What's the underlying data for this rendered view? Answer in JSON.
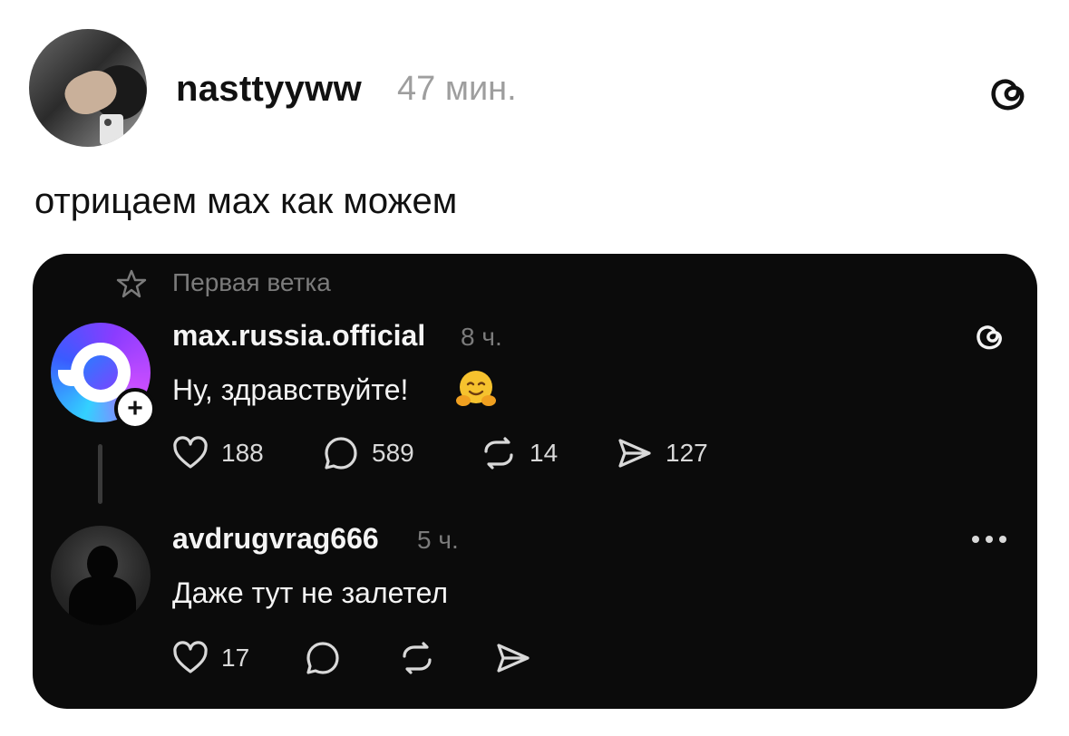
{
  "post": {
    "username": "nasttyyww",
    "time": "47 мин.",
    "text": "отрицаем мах как можем"
  },
  "embed": {
    "thread_label": "Первая ветка",
    "reply1": {
      "username": "max.russia.official",
      "time": "8 ч.",
      "text": "Ну, здравствуйте!",
      "emoji": "hugging-face",
      "follow_symbol": "+",
      "likes": "188",
      "comments": "589",
      "reposts": "14",
      "shares": "127"
    },
    "reply2": {
      "username": "avdrugvrag666",
      "time": "5 ч.",
      "text": "Даже тут не залетел",
      "likes": "17"
    }
  },
  "colors": {
    "card_bg": "#0b0b0b",
    "text_dark": "#111111",
    "text_light": "#f4f4f4",
    "muted": "#7b7b7b",
    "outer_muted": "#9e9e9e"
  }
}
